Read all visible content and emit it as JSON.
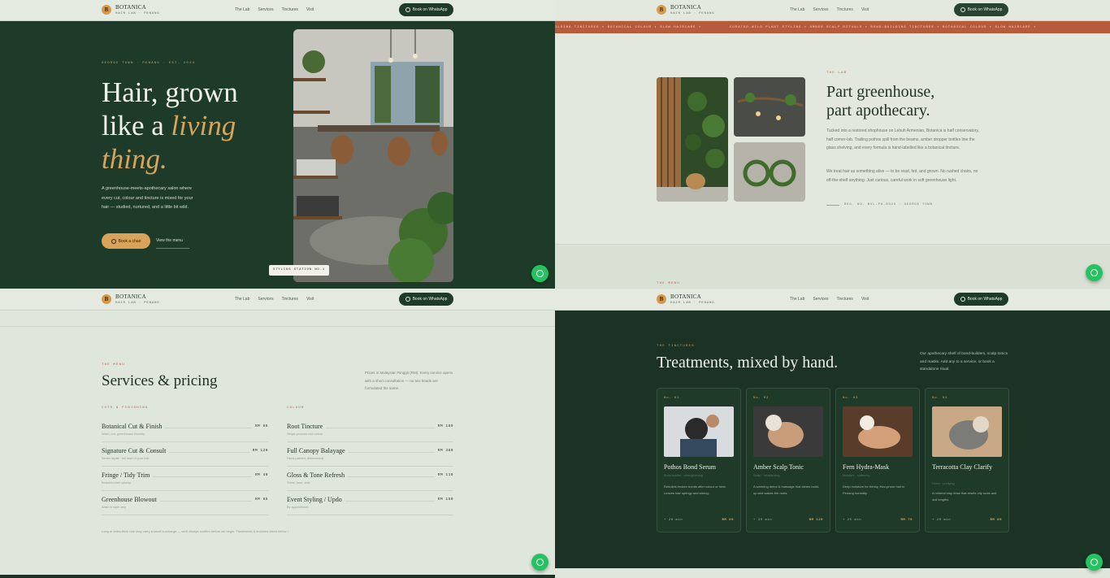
{
  "nav": {
    "brand": "BOTANICA",
    "brand_sub": "HAIR LAB · PENANG",
    "brand_initial": "B",
    "links": [
      "The Lab",
      "Services",
      "Tinctures",
      "Visit"
    ],
    "whatsapp_btn": "Book on WhatsApp"
  },
  "hero": {
    "kicker": "GEORGE TOWN · PENANG · EST. 2024",
    "title_line1": "Hair, grown",
    "title_line2a": "like a ",
    "title_line2b": "living",
    "title_line3": "thing.",
    "description": "A greenhouse-meets-apothecary salon where every cut, colour and tincture is mixed for your hair — studied, nurtured, and a little bit wild.",
    "cta_primary": "Book a chair",
    "cta_secondary": "View the menu",
    "photo_badge": "STYLING STATION NO.1"
  },
  "marquee": {
    "text": "CURATED-WILD PLANT STYLING  ✦  AMBER SCALP RITUALS  ✦  BOND-BUILDING TINCTURES  ✦  BOTANICAL COLOUR  ✦  SLOW HAIRCARE  ✦  ",
    "lead": "ILDING TINCTURES  ✦  BOTANICAL COLOUR  ✦  SLOW HAIRCARE  ✦  "
  },
  "lab": {
    "kicker": "THE LAB",
    "title_line1": "Part greenhouse,",
    "title_line2": "part apothecary.",
    "para1": "Tucked into a restored shophouse on Lebuh Armenian, Botanica is half conservatory, half corner-lab. Trailing pothos spill from the beams, amber dropper bottles line the glass shelving, and every formula is hand-labelled like a botanical tincture.",
    "para2": "We treat hair as something alive — to be read, fed, and grown. No rushed chairs, no off-the-shelf anything. Just curious, careful work in soft greenhouse light.",
    "reg": "REG. NO. BVL-PG-0324 · GEORGE TOWN"
  },
  "services": {
    "kicker": "THE MENU",
    "title": "Services & pricing",
    "note": "Prices in Malaysian Ringgit (RM). Every service opens with a short consultation — no two heads are formulated the same.",
    "col1_title": "CUTS & FINISHING",
    "col2_title": "COLOUR",
    "col1": [
      {
        "name": "Botanical Cut & Finish",
        "sub": "Wash, cut, greenhouse blowdry",
        "price": "RM 85"
      },
      {
        "name": "Signature Cut & Consult",
        "sub": "Senior stylist · full read of your hair",
        "price": "RM 120"
      },
      {
        "name": "Fringe / Tidy Trim",
        "sub": "Between-visit upkeep",
        "price": "RM 40"
      },
      {
        "name": "Greenhouse Blowout",
        "sub": "Wash & style only",
        "price": "RM 65"
      }
    ],
    "col2": [
      {
        "name": "Root Tincture",
        "sub": "Single-process root colour",
        "price": "RM 180"
      },
      {
        "name": "Full Canopy Balayage",
        "sub": "Hand-painted, dimensional",
        "price": "RM 380"
      },
      {
        "name": "Gloss & Tone Refresh",
        "sub": "Shine, tone, seal",
        "price": "RM 110"
      },
      {
        "name": "Event Styling / Updo",
        "sub": "By appointment",
        "price": "RM 150"
      }
    ],
    "foot": "Long or extra-thick hair may carry a small surcharge — we'll always confirm before we begin. Treatments & tinctures listed below ↓"
  },
  "treatments": {
    "kicker": "THE TINCTURES",
    "title": "Treatments, mixed by hand.",
    "note": "Our apothecary shelf of bond-builders, scalp tonics and masks. Add any to a service, or book a standalone ritual.",
    "cards": [
      {
        "no": "No. 01",
        "name": "Pothos Bond Serum",
        "sub": "Bond-builder · strengthening",
        "desc": "Rebuilds broken bonds after colour or heat. Leaves hair springy and strong.",
        "time": "+ 20 min",
        "price": "RM 90"
      },
      {
        "no": "No. 02",
        "name": "Amber Scalp Tonic",
        "sub": "Scalp · rebalancing",
        "desc": "A warming detox & massage that clears build-up and wakes the roots.",
        "time": "+ 30 min",
        "price": "RM 120"
      },
      {
        "no": "No. 03",
        "name": "Fern Hydra-Mask",
        "sub": "Moisture · softening",
        "desc": "Deep moisture for thirsty, frizz-prone hair in Penang humidity.",
        "time": "+ 25 min",
        "price": "RM 70"
      },
      {
        "no": "No. 04",
        "name": "Terracotta Clay Clarify",
        "sub": "Detox · purifying",
        "desc": "A mineral clay rinse that resets oily roots and dull lengths.",
        "time": "+ 20 min",
        "price": "RM 80"
      }
    ]
  },
  "colors": {
    "forest": "#1e3b29",
    "amber": "#d9a45a",
    "terracotta": "#b75b3d",
    "sage": "#dfe6db",
    "whatsapp": "#25c262"
  }
}
